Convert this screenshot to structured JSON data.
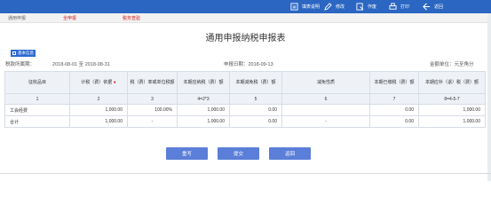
{
  "toolbar": {
    "items": [
      {
        "label": "填表说明",
        "icon": "info-icon"
      },
      {
        "label": "修改",
        "icon": "edit-icon"
      },
      {
        "label": "作废",
        "icon": "void-icon"
      },
      {
        "label": "打印",
        "icon": "print-icon"
      },
      {
        "label": "返回",
        "icon": "back-icon"
      }
    ]
  },
  "breadcrumb": {
    "items": [
      "通用申报",
      "全申报",
      "税务查验"
    ]
  },
  "page": {
    "title": "通用申报纳税申报表",
    "basic_info_label": "基本信息",
    "period_label": "税款所属期：",
    "period_value": "2018-08-01 至 2018-08-31",
    "report_date": "申报日期：2018-09-13",
    "amount_unit": "金额单位：元至角分"
  },
  "table": {
    "headers": [
      "征收品目",
      "计税（费）依据",
      "税（费）率或单位税额",
      "本期应纳税（费）额",
      "本期减免税（费）额",
      "减免性质",
      "本期已缴税（费）额",
      "本期应补（退）税（费）额"
    ],
    "index_row": [
      "",
      "1",
      "2",
      "3",
      "4=2*3",
      "5",
      "6",
      "7",
      "8=4-5-7"
    ],
    "rows": [
      {
        "item": "工会经费",
        "base": "1,000.00",
        "rate": "100.00%",
        "payable": "1,000.00",
        "relief": "0.00",
        "nature": "",
        "paid": "0.00",
        "due": "1,000.00"
      },
      {
        "item": "合计",
        "base": "1,000.00",
        "rate": "-",
        "payable": "1,000.00",
        "relief": "0.00",
        "nature": "-",
        "paid": "0.00",
        "due": "1,000.00"
      }
    ]
  },
  "actions": {
    "fill": "重写",
    "submit": "提交",
    "back": "返回"
  },
  "colors": {
    "toolbar_bg": "#2b66c2",
    "button_bg": "#5b7fd8",
    "header_bg": "#eef2f7",
    "accent_red": "#d52020"
  }
}
